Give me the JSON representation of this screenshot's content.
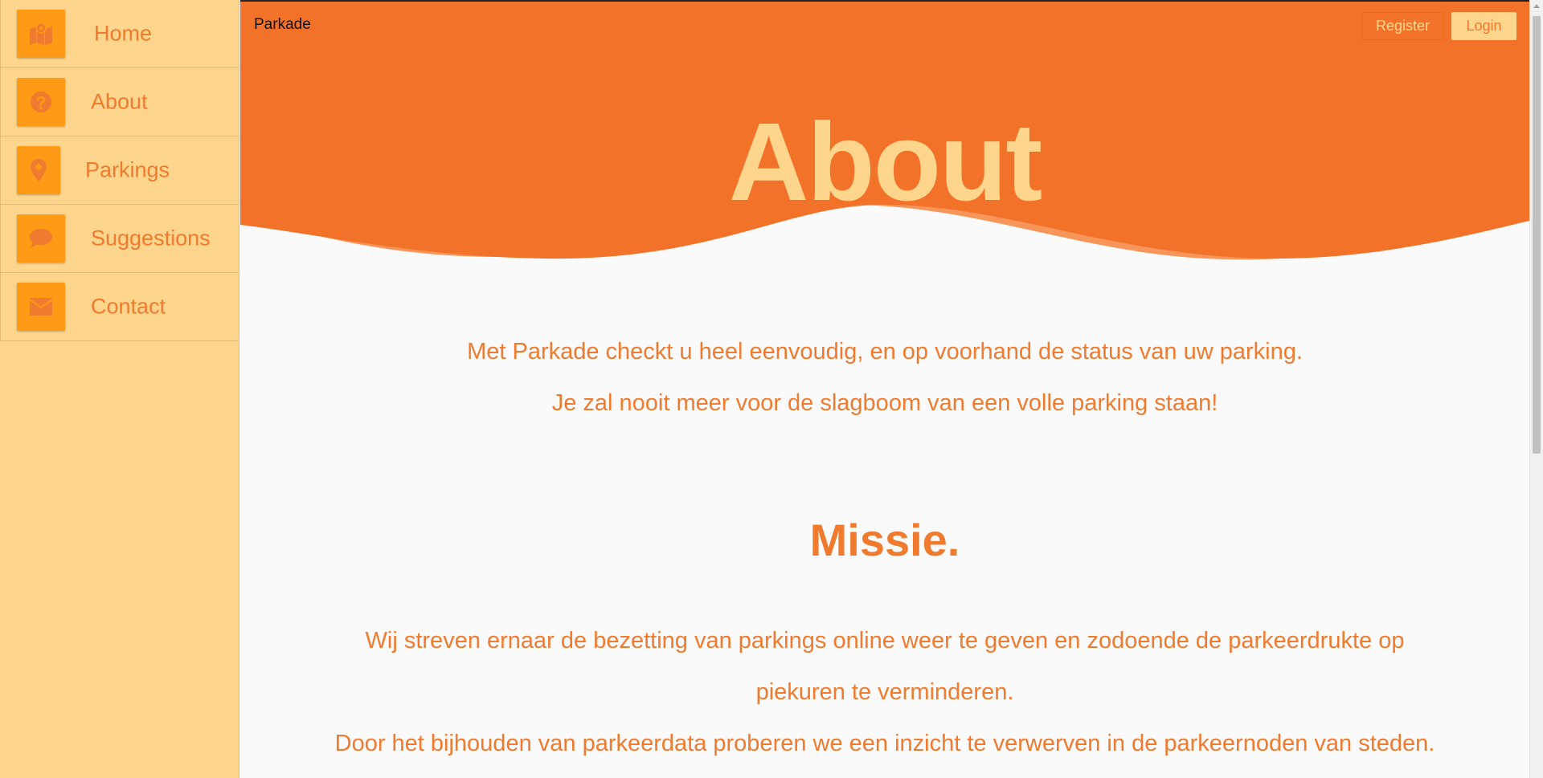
{
  "sidebar": {
    "items": [
      {
        "label": "Home",
        "icon": "map-icon"
      },
      {
        "label": "About",
        "icon": "question-icon"
      },
      {
        "label": "Parkings",
        "icon": "map-pin-icon"
      },
      {
        "label": "Suggestions",
        "icon": "comment-icon"
      },
      {
        "label": "Contact",
        "icon": "envelope-icon"
      }
    ]
  },
  "header": {
    "brand": "Parkade",
    "register_label": "Register",
    "login_label": "Login"
  },
  "hero": {
    "title": "About"
  },
  "intro": {
    "line1": "Met Parkade checkt u heel eenvoudig, en op voorhand de status van uw parking.",
    "line2": "Je zal nooit meer voor de slagboom van een volle parking staan!"
  },
  "mission": {
    "title": "Missie.",
    "line1": "Wij streven ernaar de bezetting van parkings online weer te geven en zodoende de parkeerdrukte op",
    "line2": "piekuren te verminderen.",
    "line3": "Door het bijhouden van parkeerdata proberen we een inzicht te verwerven in de parkeernoden van steden."
  },
  "colors": {
    "orange": "#f3722a",
    "light_yellow": "#fdd58c",
    "icon_orange": "#ff9a16",
    "text_orange": "#f07a2e"
  }
}
